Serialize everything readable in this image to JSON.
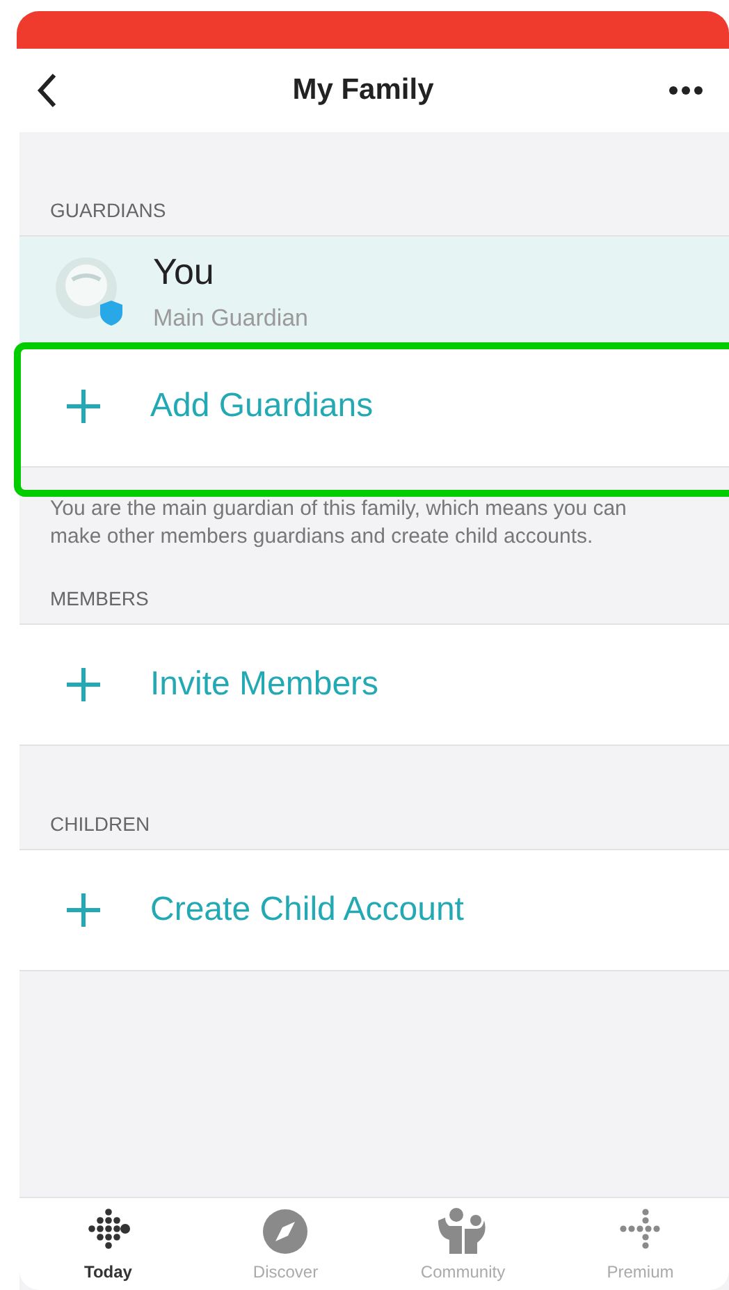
{
  "header": {
    "title": "My Family"
  },
  "sections": [
    {
      "heading": "GUARDIANS",
      "rows": [
        {
          "kind": "person",
          "name": "You",
          "role": "Main Guardian"
        },
        {
          "kind": "action",
          "label": "Add Guardians",
          "highlighted": true
        }
      ],
      "note": "You are the main guardian of this family, which means you can make other members guardians and create child accounts."
    },
    {
      "heading": "MEMBERS",
      "rows": [
        {
          "kind": "action",
          "label": "Invite Members",
          "highlighted": false
        }
      ]
    },
    {
      "heading": "CHILDREN",
      "rows": [
        {
          "kind": "action",
          "label": "Create Child Account",
          "highlighted": false
        }
      ]
    }
  ],
  "tabs": [
    {
      "label": "Today",
      "selected": true
    },
    {
      "label": "Discover",
      "selected": false
    },
    {
      "label": "Community",
      "selected": false
    },
    {
      "label": "Premium",
      "selected": false
    }
  ]
}
